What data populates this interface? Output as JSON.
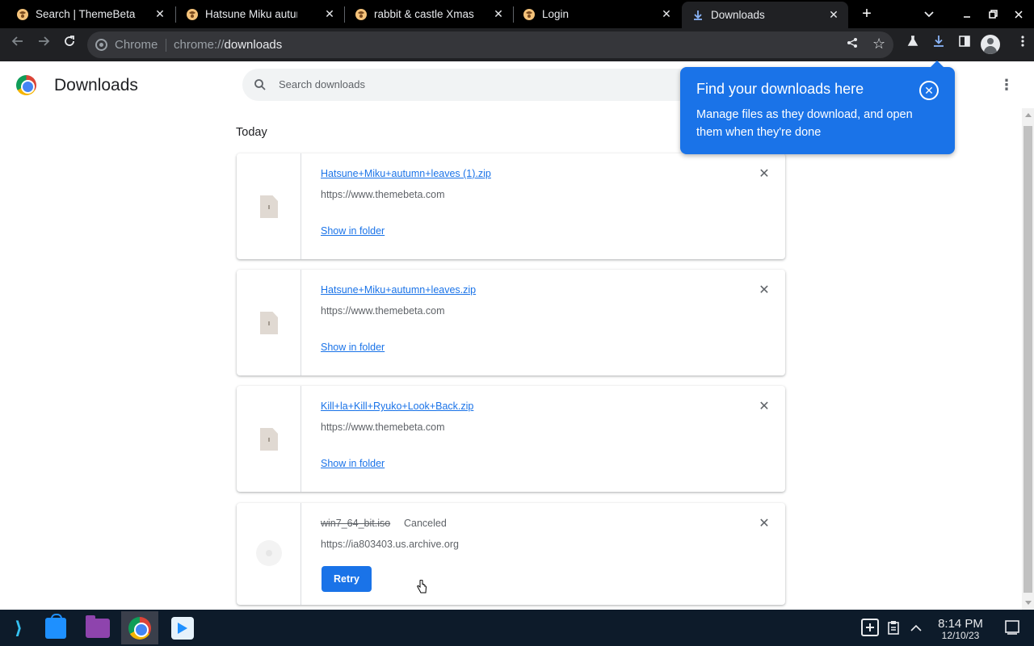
{
  "tabs": [
    {
      "title": "Search | ThemeBeta",
      "favicon": "themebeta-icon"
    },
    {
      "title": "Hatsune Miku autumn leaves",
      "favicon": "themebeta-icon"
    },
    {
      "title": "rabbit & castle Xmas",
      "favicon": "themebeta-icon"
    },
    {
      "title": "Login",
      "favicon": "themebeta-icon"
    },
    {
      "title": "Downloads",
      "favicon": "download-icon",
      "active": true
    }
  ],
  "omnibox": {
    "chip": "Chrome",
    "scheme": "chrome://",
    "host": "downloads"
  },
  "header": {
    "title": "Downloads",
    "search_placeholder": "Search downloads"
  },
  "section": {
    "label": "Today"
  },
  "downloads": [
    {
      "name": "Hatsune+Miku+autumn+leaves (1).zip",
      "source": "https://www.themebeta.com",
      "action": "Show in folder"
    },
    {
      "name": "Hatsune+Miku+autumn+leaves.zip",
      "source": "https://www.themebeta.com",
      "action": "Show in folder"
    },
    {
      "name": "Kill+la+Kill+Ryuko+Look+Back.zip",
      "source": "https://www.themebeta.com",
      "action": "Show in folder"
    },
    {
      "name": "win7_64_bit.iso",
      "status": "Canceled",
      "source": "https://ia803403.us.archive.org",
      "action": "Retry"
    }
  ],
  "bubble": {
    "title": "Find your downloads here",
    "body": "Manage files as they download, and open them when they're done"
  },
  "clock": {
    "time": "8:14 PM",
    "date": "12/10/23"
  },
  "colors": {
    "accent": "#1a73e8",
    "tabbar": "#000000",
    "toolbar": "#202124",
    "taskbar": "#0d1b2a"
  }
}
